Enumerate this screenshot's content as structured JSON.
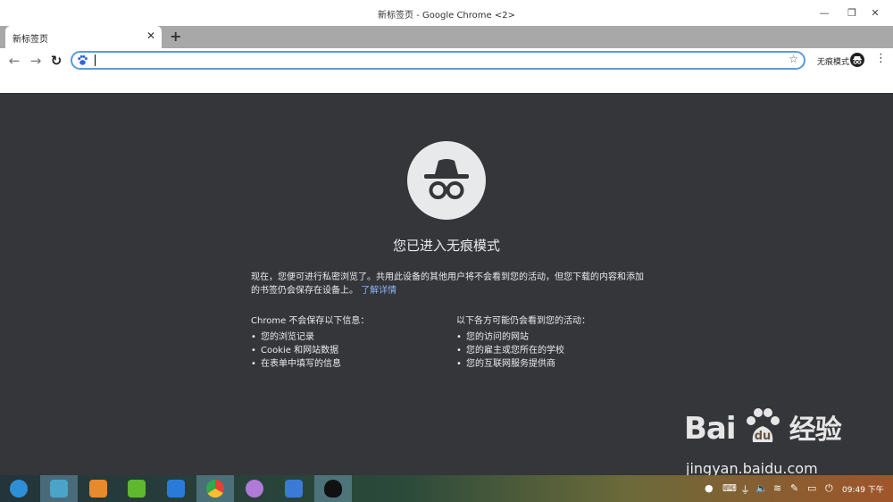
{
  "window": {
    "title": "新标签页 - Google Chrome <2>",
    "minimize_glyph": "—",
    "maximize_glyph": "❐",
    "close_glyph": "✕"
  },
  "tabs": [
    {
      "label": "新标签页",
      "close_glyph": "✕"
    }
  ],
  "new_tab_glyph": "+",
  "toolbar": {
    "back_glyph": "←",
    "forward_glyph": "→",
    "reload_glyph": "↻",
    "omnibox_value": "",
    "bookmark_glyph": "☆",
    "incognito_label": "无痕模式",
    "menu_glyph": "⋮"
  },
  "incognito_page": {
    "heading": "您已进入无痕模式",
    "description": "现在，您便可进行私密浏览了。共用此设备的其他用户将不会看到您的活动，但您下载的内容和添加的书签仍会保存在设备上。",
    "learn_more": "了解详情",
    "left_column": {
      "heading": "Chrome 不会保存以下信息：",
      "items": [
        "您的浏览记录",
        "Cookie 和网站数据",
        "在表单中填写的信息"
      ]
    },
    "right_column": {
      "heading": "以下各方可能仍会看到您的活动：",
      "items": [
        "您的访问的网站",
        "您的雇主或您所在的学校",
        "您的互联网服务提供商"
      ]
    }
  },
  "watermark": {
    "brand": "Bai",
    "brand_suffix": "经验",
    "url": "jingyan.baidu.com"
  },
  "taskbar": {
    "apps": [
      {
        "name": "launcher-icon",
        "color": "#2e8fd6"
      },
      {
        "name": "file-manager-icon",
        "color": "#4aa3c8"
      },
      {
        "name": "app-store-icon",
        "color": "#e68a2e"
      },
      {
        "name": "music-player-icon",
        "color": "#5fb830"
      },
      {
        "name": "video-player-icon",
        "color": "#2a7bd8"
      },
      {
        "name": "chrome-icon",
        "color": "#e34133"
      },
      {
        "name": "settings-icon",
        "color": "#b07ad8"
      },
      {
        "name": "wps-writer-icon",
        "color": "#3a7bd5"
      },
      {
        "name": "qq-icon",
        "color": "#111111"
      }
    ],
    "clock": "09:49 下午"
  },
  "colors": {
    "accent": "#5b9ad9",
    "incognito_bg": "#35363a",
    "link": "#8ab4f8"
  }
}
